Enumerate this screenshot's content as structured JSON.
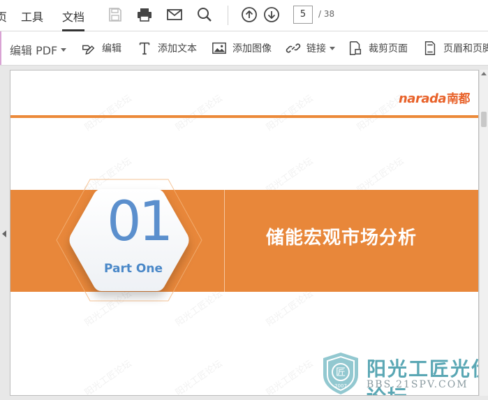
{
  "menubar": {
    "tabs": [
      "页",
      "工具",
      "文档"
    ],
    "active_tab": "文档",
    "page_current": "5",
    "page_total": "/ 38"
  },
  "toolbar": {
    "title": "编辑 PDF",
    "items": [
      "编辑",
      "添加文本",
      "添加图像",
      "链接",
      "裁剪页面",
      "页眉和页脚"
    ]
  },
  "slide": {
    "brand_latin": "narada",
    "brand_cn": "南都",
    "number": "01",
    "subtitle": "Part One",
    "section_title": "储能宏观市场分析",
    "watermark_text": "阳光工匠论坛"
  },
  "forum_logo": {
    "name": "阳光工匠光伏论坛",
    "url": "BBS.21SPV.COM",
    "badge_year": "2007",
    "badge_char": "匠"
  },
  "colors": {
    "orange": "#e8873a",
    "brand_red": "#e8622a",
    "blue": "#5b8fcd",
    "forum_teal": "#5aa7b4"
  }
}
